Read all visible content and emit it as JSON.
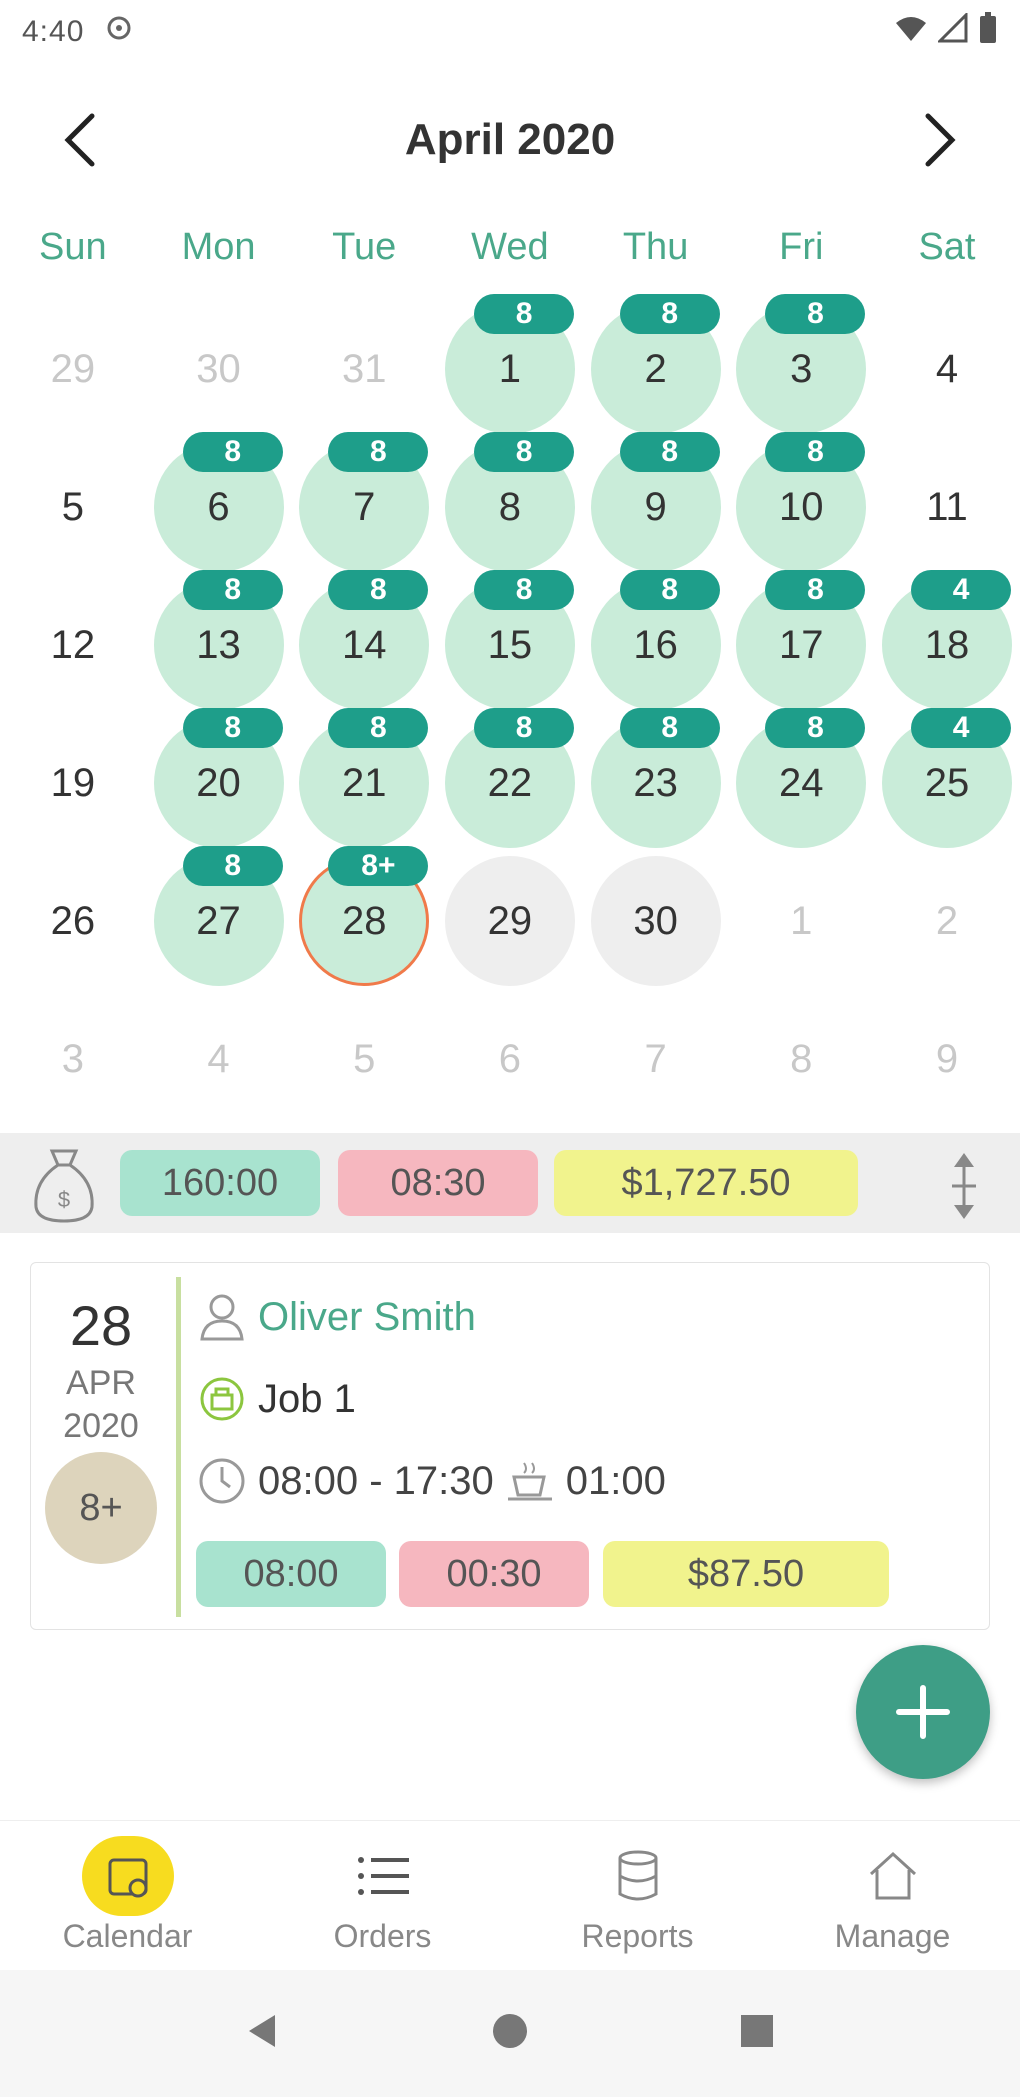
{
  "status": {
    "time": "4:40"
  },
  "header": {
    "month_title": "April 2020"
  },
  "weekdays": [
    "Sun",
    "Mon",
    "Tue",
    "Wed",
    "Thu",
    "Fri",
    "Sat"
  ],
  "calendar": {
    "weeks": [
      [
        {
          "d": "29",
          "m": true
        },
        {
          "d": "30",
          "m": true
        },
        {
          "d": "31",
          "m": true
        },
        {
          "d": "1",
          "s": "work",
          "b": "8"
        },
        {
          "d": "2",
          "s": "work",
          "b": "8"
        },
        {
          "d": "3",
          "s": "work",
          "b": "8"
        },
        {
          "d": "4"
        }
      ],
      [
        {
          "d": "5"
        },
        {
          "d": "6",
          "s": "work",
          "b": "8"
        },
        {
          "d": "7",
          "s": "work",
          "b": "8"
        },
        {
          "d": "8",
          "s": "work",
          "b": "8"
        },
        {
          "d": "9",
          "s": "work",
          "b": "8"
        },
        {
          "d": "10",
          "s": "work",
          "b": "8"
        },
        {
          "d": "11"
        }
      ],
      [
        {
          "d": "12"
        },
        {
          "d": "13",
          "s": "work",
          "b": "8"
        },
        {
          "d": "14",
          "s": "work",
          "b": "8"
        },
        {
          "d": "15",
          "s": "work",
          "b": "8"
        },
        {
          "d": "16",
          "s": "work",
          "b": "8"
        },
        {
          "d": "17",
          "s": "work",
          "b": "8"
        },
        {
          "d": "18",
          "s": "work",
          "b": "4"
        }
      ],
      [
        {
          "d": "19"
        },
        {
          "d": "20",
          "s": "work",
          "b": "8"
        },
        {
          "d": "21",
          "s": "work",
          "b": "8"
        },
        {
          "d": "22",
          "s": "work",
          "b": "8"
        },
        {
          "d": "23",
          "s": "work",
          "b": "8"
        },
        {
          "d": "24",
          "s": "work",
          "b": "8"
        },
        {
          "d": "25",
          "s": "work",
          "b": "4"
        }
      ],
      [
        {
          "d": "26"
        },
        {
          "d": "27",
          "s": "work",
          "b": "8"
        },
        {
          "d": "28",
          "s": "today",
          "b": "8+"
        },
        {
          "d": "29",
          "s": "grey"
        },
        {
          "d": "30",
          "s": "grey"
        },
        {
          "d": "1",
          "m": true
        },
        {
          "d": "2",
          "m": true
        }
      ],
      [
        {
          "d": "3",
          "m": true
        },
        {
          "d": "4",
          "m": true
        },
        {
          "d": "5",
          "m": true
        },
        {
          "d": "6",
          "m": true
        },
        {
          "d": "7",
          "m": true
        },
        {
          "d": "8",
          "m": true
        },
        {
          "d": "9",
          "m": true
        }
      ]
    ]
  },
  "summary": {
    "hours": "160:00",
    "overtime": "08:30",
    "earnings": "$1,727.50"
  },
  "entry": {
    "day": "28",
    "month": "APR",
    "year": "2020",
    "badge": "8+",
    "client": "Oliver Smith",
    "job": "Job 1",
    "time_range": "08:00 - 17:30",
    "break": "01:00",
    "hours": "08:00",
    "overtime": "00:30",
    "earnings": "$87.50"
  },
  "nav": {
    "calendar": "Calendar",
    "orders": "Orders",
    "reports": "Reports",
    "manage": "Manage"
  },
  "colors": {
    "accent": "#3e9e86",
    "weekday_text": "#4aa88a",
    "badge": "#1e9e8a",
    "work_day": "#c9ecd9",
    "today_ring": "#f07a4a",
    "hours_pill": "#a8e3cf",
    "overtime_pill": "#f6b7bf",
    "earnings_pill": "#f1f38d",
    "active_nav": "#f7dc1f"
  }
}
